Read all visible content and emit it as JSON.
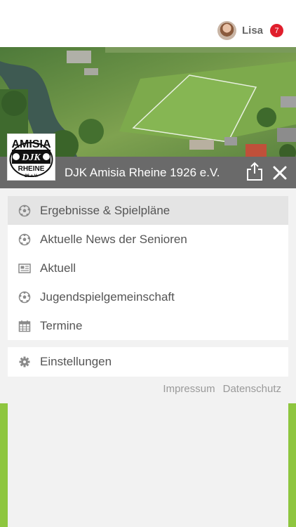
{
  "user": {
    "name": "Lisa",
    "notifications": "7"
  },
  "club": {
    "name": "DJK Amisia Rheine 1926 e.V.",
    "logo_top": "AMISIA",
    "logo_mid": "DJK",
    "logo_bottom": "RHEINE",
    "logo_year": "26 e.V."
  },
  "menu": {
    "items": [
      {
        "label": "Ergebnisse & Spielpläne",
        "icon": "soccer-ball-icon"
      },
      {
        "label": "Aktuelle News der Senioren",
        "icon": "soccer-ball-icon"
      },
      {
        "label": "Aktuell",
        "icon": "newspaper-icon"
      },
      {
        "label": "Jugendspielgemeinschaft",
        "icon": "soccer-ball-icon"
      },
      {
        "label": "Termine",
        "icon": "calendar-icon"
      }
    ],
    "settings_label": "Einstellungen"
  },
  "footer": {
    "impressum": "Impressum",
    "datenschutz": "Datenschutz"
  },
  "colors": {
    "accent_green": "#8ec63f",
    "club_bar": "#6a6a6a",
    "badge": "#e01e2c"
  }
}
